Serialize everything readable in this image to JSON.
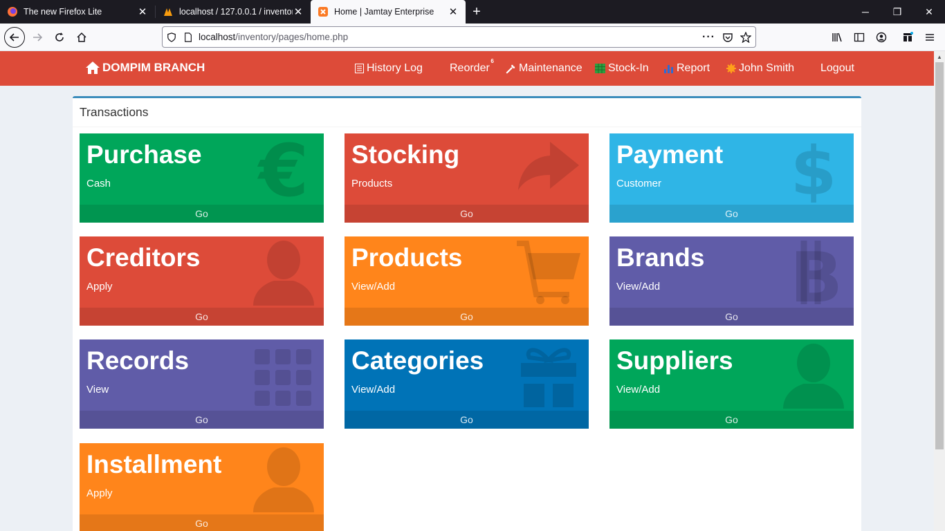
{
  "browser": {
    "tabs": [
      {
        "title": "The new Firefox Lite",
        "active": false
      },
      {
        "title": "localhost / 127.0.0.1 / inventory",
        "active": false
      },
      {
        "title": "Home | Jamtay Enterprise",
        "active": true
      }
    ],
    "url_host": "localhost",
    "url_path": "/inventory/pages/home.php"
  },
  "colors": {
    "header": "#dd4b39",
    "green": "#00a65a",
    "red": "#dd4b39",
    "aqua": "#2fb5e6",
    "orange": "#ff851b",
    "purple": "#605ca8",
    "blue": "#0073b7"
  },
  "header": {
    "brand": "DOMPIM BRANCH",
    "menu": {
      "history_log": "History Log",
      "reorder": "Reorder",
      "reorder_badge": "6",
      "maintenance": "Maintenance",
      "stock_in": "Stock-In",
      "report": "Report",
      "user": "John Smith",
      "logout": "Logout"
    }
  },
  "panel": {
    "title": "Transactions"
  },
  "tiles": [
    {
      "title": "Purchase",
      "sub": "Cash",
      "footer": "Go",
      "color": "green",
      "icon": "euro-icon"
    },
    {
      "title": "Stocking",
      "sub": "Products",
      "footer": "Go",
      "color": "red",
      "icon": "share-arrow-icon"
    },
    {
      "title": "Payment",
      "sub": "Customer",
      "footer": "Go",
      "color": "aqua",
      "icon": "dollar-icon"
    },
    {
      "title": "Creditors",
      "sub": "Apply",
      "footer": "Go",
      "color": "red",
      "icon": "user-icon"
    },
    {
      "title": "Products",
      "sub": "View/Add",
      "footer": "Go",
      "color": "orange",
      "icon": "cart-icon"
    },
    {
      "title": "Brands",
      "sub": "View/Add",
      "footer": "Go",
      "color": "purple",
      "icon": "bitcoin-icon"
    },
    {
      "title": "Records",
      "sub": "View",
      "footer": "Go",
      "color": "purple",
      "icon": "grid-icon"
    },
    {
      "title": "Categories",
      "sub": "View/Add",
      "footer": "Go",
      "color": "blue",
      "icon": "gift-icon"
    },
    {
      "title": "Suppliers",
      "sub": "View/Add",
      "footer": "Go",
      "color": "green",
      "icon": "user-icon"
    },
    {
      "title": "Installment",
      "sub": "Apply",
      "footer": "Go",
      "color": "orange",
      "icon": "user-icon"
    }
  ]
}
